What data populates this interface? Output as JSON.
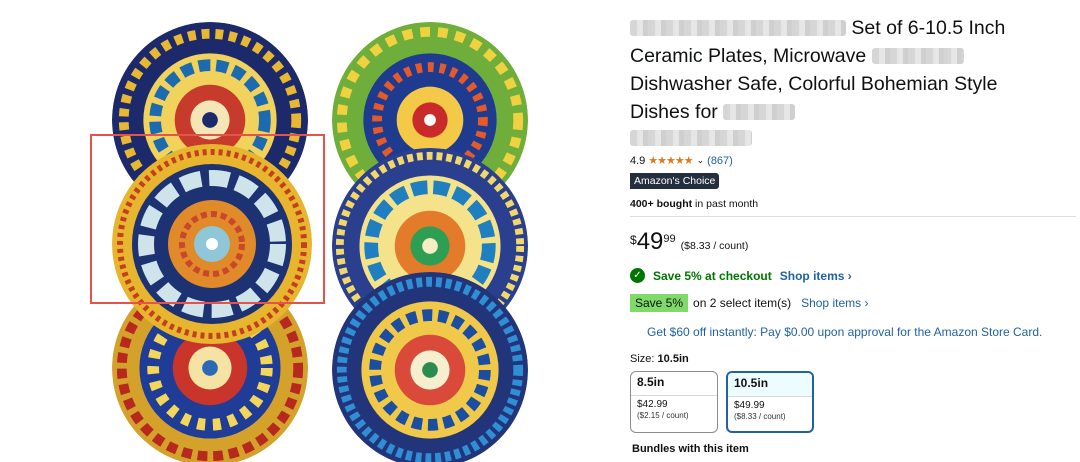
{
  "product": {
    "title_visible": "Set of 6-10.5 Inch Ceramic Plates, Microwave",
    "title_line3": "Dishwasher Safe, Colorful Bohemian Style",
    "title_line4_prefix": "Dishes for",
    "rating": "4.9",
    "stars": "★★★★★",
    "review_count": "(867)",
    "badge": "Amazon's Choice",
    "bought_bold": "400+ bought",
    "bought_rest": " in past month"
  },
  "price": {
    "symbol": "$",
    "whole": "49",
    "fraction": "99",
    "unit": "($8.33 / count)"
  },
  "savings": {
    "check_text": "Save 5% at checkout",
    "check_link": "Shop items ›",
    "promo_badge": "Save 5%",
    "promo_text": "on 2 select item(s)",
    "promo_link": "Shop items ›",
    "card_offer": "Get $60 off instantly: Pay $0.00 upon approval for the Amazon Store Card."
  },
  "size": {
    "label": "Size:",
    "selected": "10.5in",
    "options": [
      {
        "name": "8.5in",
        "price": "$42.99",
        "unit": "($2.15 / count)"
      },
      {
        "name": "10.5in",
        "price": "$49.99",
        "unit": "($8.33 / count)"
      }
    ]
  },
  "bundles_heading": "Bundles with this item",
  "colors": {
    "link": "#2162a1",
    "star": "#de7921",
    "green": "#007600",
    "promo": "#7fda69",
    "highlight": "#e5534b"
  }
}
